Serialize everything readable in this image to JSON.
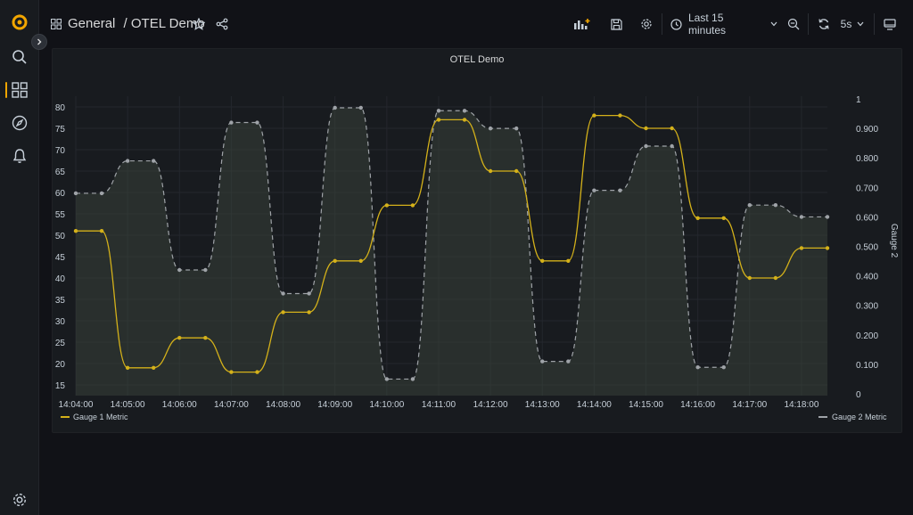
{
  "breadcrumb": {
    "folder": "General",
    "separator": "/",
    "dashboard": "OTEL Demo"
  },
  "toolbar": {
    "time_range": "Last 15 minutes",
    "refresh_interval": "5s"
  },
  "panel": {
    "title": "OTEL Demo"
  },
  "colors": {
    "accent": "#f2a600",
    "series1": "#d4b11a",
    "series2": "#9fa3a8"
  },
  "chart_data": {
    "type": "line",
    "title": "OTEL Demo",
    "x": [
      "14:04:00",
      "14:04:30",
      "14:05:00",
      "14:05:30",
      "14:06:00",
      "14:06:30",
      "14:07:00",
      "14:07:30",
      "14:08:00",
      "14:08:30",
      "14:09:00",
      "14:09:30",
      "14:10:00",
      "14:10:30",
      "14:11:00",
      "14:11:30",
      "14:12:00",
      "14:12:30",
      "14:13:00",
      "14:13:30",
      "14:14:00",
      "14:14:30",
      "14:15:00",
      "14:15:30",
      "14:16:00",
      "14:16:30",
      "14:17:00",
      "14:17:30",
      "14:18:00",
      "14:18:30"
    ],
    "x_ticks": [
      "14:04:00",
      "14:05:00",
      "14:06:00",
      "14:07:00",
      "14:08:00",
      "14:09:00",
      "14:10:00",
      "14:11:00",
      "14:12:00",
      "14:13:00",
      "14:14:00",
      "14:15:00",
      "14:16:00",
      "14:17:00",
      "14:18:00"
    ],
    "series": [
      {
        "name": "Gauge 1 Metric",
        "axis": "left",
        "color": "#d4b11a",
        "values": [
          51,
          51,
          19,
          19,
          26,
          26,
          18,
          18,
          32,
          32,
          44,
          44,
          57,
          57,
          77,
          77,
          65,
          65,
          44,
          44,
          78,
          78,
          75,
          75,
          54,
          54,
          40,
          40,
          47,
          47
        ]
      },
      {
        "name": "Gauge 2 Metric",
        "axis": "right",
        "color": "#9fa3a8",
        "values": [
          0.68,
          0.68,
          0.79,
          0.79,
          0.42,
          0.42,
          0.92,
          0.92,
          0.34,
          0.34,
          0.97,
          0.97,
          0.05,
          0.05,
          0.96,
          0.96,
          0.9,
          0.9,
          0.11,
          0.11,
          0.69,
          0.69,
          0.84,
          0.84,
          0.09,
          0.09,
          0.64,
          0.64,
          0.6,
          0.6
        ]
      }
    ],
    "y_left": {
      "ticks": [
        "15",
        "20",
        "25",
        "30",
        "35",
        "40",
        "45",
        "50",
        "55",
        "60",
        "65",
        "70",
        "75",
        "80"
      ],
      "min": 12.5,
      "max": 82.5
    },
    "y_right": {
      "label": "Gauge 2",
      "ticks": [
        "0",
        "0.100",
        "0.200",
        "0.300",
        "0.400",
        "0.500",
        "0.600",
        "0.700",
        "0.800",
        "0.900",
        "1"
      ],
      "min": 0,
      "max": 1
    },
    "grid": true,
    "legend": {
      "left": "Gauge 1 Metric",
      "right": "Gauge 2 Metric",
      "placement": "bottom"
    }
  }
}
